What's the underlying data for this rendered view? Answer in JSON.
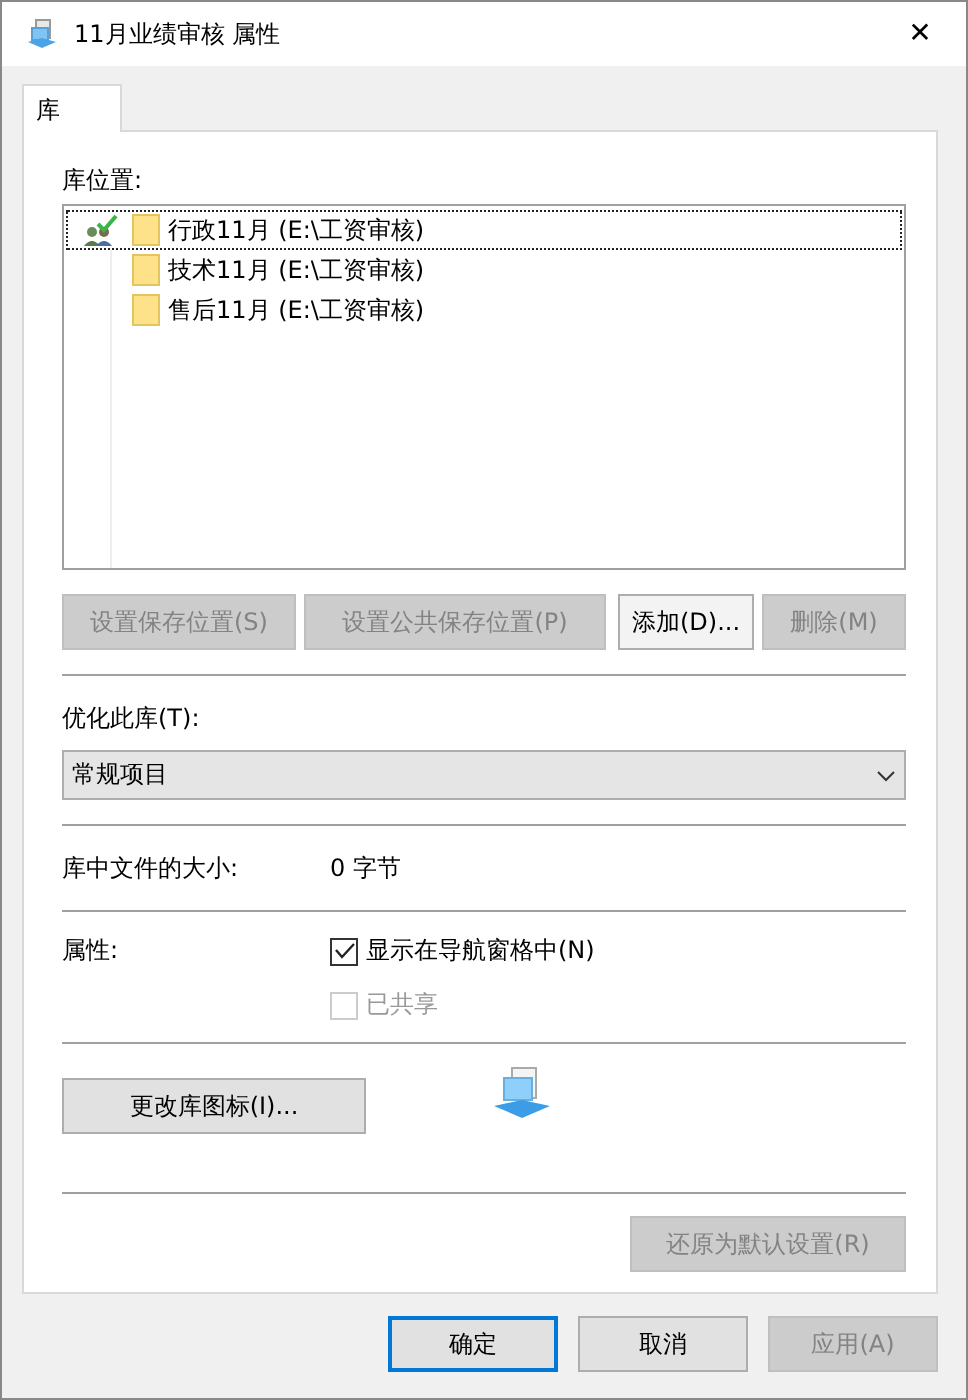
{
  "window": {
    "title": "11月业绩审核 属性",
    "close": "✕"
  },
  "tabs": [
    {
      "label": "库",
      "selected": true
    }
  ],
  "locations_label": "库位置:",
  "locations": [
    {
      "name": "行政11月 (E:\\工资审核)",
      "save_location": true,
      "selected": true
    },
    {
      "name": "技术11月 (E:\\工资审核)",
      "save_location": false,
      "selected": false
    },
    {
      "name": "售后11月 (E:\\工资审核)",
      "save_location": false,
      "selected": false
    }
  ],
  "location_buttons": [
    {
      "label": "设置保存位置(S)",
      "disabled": true
    },
    {
      "label": "设置公共保存位置(P)",
      "disabled": true
    },
    {
      "label": "添加(D)...",
      "disabled": false
    },
    {
      "label": "删除(M)",
      "disabled": true
    }
  ],
  "optimize_label": "优化此库(T):",
  "optimize_select": {
    "value": "常规项目"
  },
  "size": {
    "label": "库中文件的大小:",
    "value": "0 字节"
  },
  "attributes_label": "属性:",
  "attributes": [
    {
      "label": "显示在导航窗格中(N)",
      "checked": true,
      "disabled": false
    },
    {
      "label": "已共享",
      "checked": false,
      "disabled": true
    }
  ],
  "change_icon_button": {
    "label": "更改库图标(I)...",
    "disabled": false
  },
  "restore_button": {
    "label": "还原为默认设置(R)",
    "disabled": true
  },
  "dialog_buttons": [
    {
      "label": "确定",
      "default": true,
      "disabled": false
    },
    {
      "label": "取消",
      "default": false,
      "disabled": false
    },
    {
      "label": "应用(A)",
      "default": false,
      "disabled": true
    }
  ]
}
